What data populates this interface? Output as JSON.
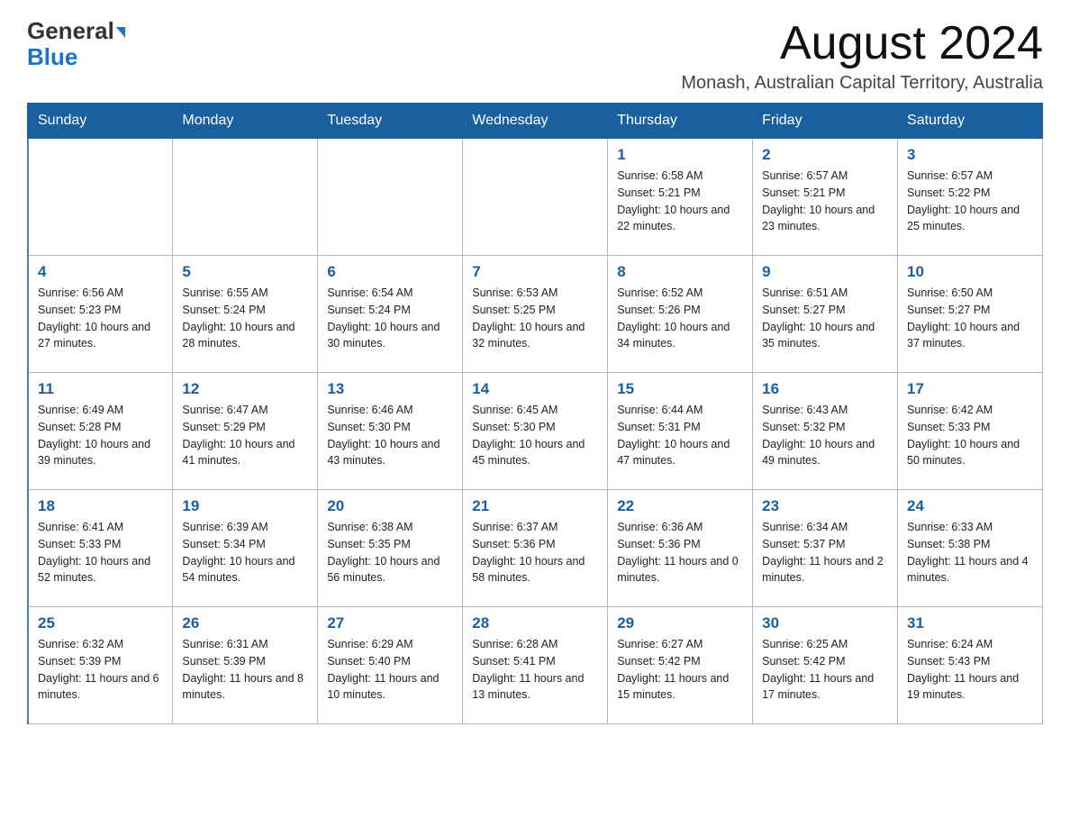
{
  "header": {
    "logo_general": "General",
    "logo_blue": "Blue",
    "month_title": "August 2024",
    "location": "Monash, Australian Capital Territory, Australia"
  },
  "columns": [
    "Sunday",
    "Monday",
    "Tuesday",
    "Wednesday",
    "Thursday",
    "Friday",
    "Saturday"
  ],
  "weeks": [
    [
      {
        "day": "",
        "info": ""
      },
      {
        "day": "",
        "info": ""
      },
      {
        "day": "",
        "info": ""
      },
      {
        "day": "",
        "info": ""
      },
      {
        "day": "1",
        "info": "Sunrise: 6:58 AM\nSunset: 5:21 PM\nDaylight: 10 hours and 22 minutes."
      },
      {
        "day": "2",
        "info": "Sunrise: 6:57 AM\nSunset: 5:21 PM\nDaylight: 10 hours and 23 minutes."
      },
      {
        "day": "3",
        "info": "Sunrise: 6:57 AM\nSunset: 5:22 PM\nDaylight: 10 hours and 25 minutes."
      }
    ],
    [
      {
        "day": "4",
        "info": "Sunrise: 6:56 AM\nSunset: 5:23 PM\nDaylight: 10 hours and 27 minutes."
      },
      {
        "day": "5",
        "info": "Sunrise: 6:55 AM\nSunset: 5:24 PM\nDaylight: 10 hours and 28 minutes."
      },
      {
        "day": "6",
        "info": "Sunrise: 6:54 AM\nSunset: 5:24 PM\nDaylight: 10 hours and 30 minutes."
      },
      {
        "day": "7",
        "info": "Sunrise: 6:53 AM\nSunset: 5:25 PM\nDaylight: 10 hours and 32 minutes."
      },
      {
        "day": "8",
        "info": "Sunrise: 6:52 AM\nSunset: 5:26 PM\nDaylight: 10 hours and 34 minutes."
      },
      {
        "day": "9",
        "info": "Sunrise: 6:51 AM\nSunset: 5:27 PM\nDaylight: 10 hours and 35 minutes."
      },
      {
        "day": "10",
        "info": "Sunrise: 6:50 AM\nSunset: 5:27 PM\nDaylight: 10 hours and 37 minutes."
      }
    ],
    [
      {
        "day": "11",
        "info": "Sunrise: 6:49 AM\nSunset: 5:28 PM\nDaylight: 10 hours and 39 minutes."
      },
      {
        "day": "12",
        "info": "Sunrise: 6:47 AM\nSunset: 5:29 PM\nDaylight: 10 hours and 41 minutes."
      },
      {
        "day": "13",
        "info": "Sunrise: 6:46 AM\nSunset: 5:30 PM\nDaylight: 10 hours and 43 minutes."
      },
      {
        "day": "14",
        "info": "Sunrise: 6:45 AM\nSunset: 5:30 PM\nDaylight: 10 hours and 45 minutes."
      },
      {
        "day": "15",
        "info": "Sunrise: 6:44 AM\nSunset: 5:31 PM\nDaylight: 10 hours and 47 minutes."
      },
      {
        "day": "16",
        "info": "Sunrise: 6:43 AM\nSunset: 5:32 PM\nDaylight: 10 hours and 49 minutes."
      },
      {
        "day": "17",
        "info": "Sunrise: 6:42 AM\nSunset: 5:33 PM\nDaylight: 10 hours and 50 minutes."
      }
    ],
    [
      {
        "day": "18",
        "info": "Sunrise: 6:41 AM\nSunset: 5:33 PM\nDaylight: 10 hours and 52 minutes."
      },
      {
        "day": "19",
        "info": "Sunrise: 6:39 AM\nSunset: 5:34 PM\nDaylight: 10 hours and 54 minutes."
      },
      {
        "day": "20",
        "info": "Sunrise: 6:38 AM\nSunset: 5:35 PM\nDaylight: 10 hours and 56 minutes."
      },
      {
        "day": "21",
        "info": "Sunrise: 6:37 AM\nSunset: 5:36 PM\nDaylight: 10 hours and 58 minutes."
      },
      {
        "day": "22",
        "info": "Sunrise: 6:36 AM\nSunset: 5:36 PM\nDaylight: 11 hours and 0 minutes."
      },
      {
        "day": "23",
        "info": "Sunrise: 6:34 AM\nSunset: 5:37 PM\nDaylight: 11 hours and 2 minutes."
      },
      {
        "day": "24",
        "info": "Sunrise: 6:33 AM\nSunset: 5:38 PM\nDaylight: 11 hours and 4 minutes."
      }
    ],
    [
      {
        "day": "25",
        "info": "Sunrise: 6:32 AM\nSunset: 5:39 PM\nDaylight: 11 hours and 6 minutes."
      },
      {
        "day": "26",
        "info": "Sunrise: 6:31 AM\nSunset: 5:39 PM\nDaylight: 11 hours and 8 minutes."
      },
      {
        "day": "27",
        "info": "Sunrise: 6:29 AM\nSunset: 5:40 PM\nDaylight: 11 hours and 10 minutes."
      },
      {
        "day": "28",
        "info": "Sunrise: 6:28 AM\nSunset: 5:41 PM\nDaylight: 11 hours and 13 minutes."
      },
      {
        "day": "29",
        "info": "Sunrise: 6:27 AM\nSunset: 5:42 PM\nDaylight: 11 hours and 15 minutes."
      },
      {
        "day": "30",
        "info": "Sunrise: 6:25 AM\nSunset: 5:42 PM\nDaylight: 11 hours and 17 minutes."
      },
      {
        "day": "31",
        "info": "Sunrise: 6:24 AM\nSunset: 5:43 PM\nDaylight: 11 hours and 19 minutes."
      }
    ]
  ]
}
